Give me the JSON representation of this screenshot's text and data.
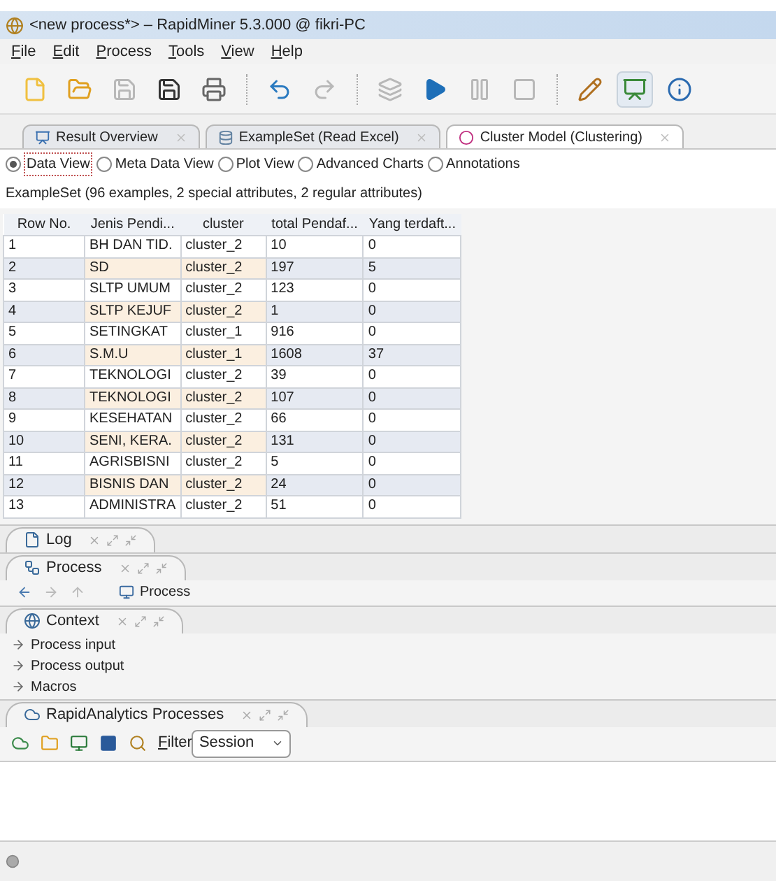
{
  "window": {
    "title": "<new process*> – RapidMiner 5.3.000 @ fikri-PC"
  },
  "menu": [
    {
      "label": "File"
    },
    {
      "label": "Edit"
    },
    {
      "label": "Process"
    },
    {
      "label": "Tools"
    },
    {
      "label": "View"
    },
    {
      "label": "Help"
    }
  ],
  "toolbar": [
    {
      "kind": "new",
      "disabled": false
    },
    {
      "kind": "open",
      "disabled": false
    },
    {
      "kind": "save",
      "disabled": true
    },
    {
      "kind": "saveas",
      "disabled": false
    },
    {
      "kind": "print",
      "disabled": false
    },
    {
      "kind": "sep"
    },
    {
      "kind": "undo",
      "disabled": false
    },
    {
      "kind": "redo",
      "disabled": true
    },
    {
      "kind": "sep"
    },
    {
      "kind": "stack",
      "disabled": true
    },
    {
      "kind": "run",
      "disabled": false
    },
    {
      "kind": "pause",
      "disabled": true
    },
    {
      "kind": "stop",
      "disabled": true
    },
    {
      "kind": "sep"
    },
    {
      "kind": "design",
      "disabled": false,
      "selected": false
    },
    {
      "kind": "results",
      "disabled": false,
      "selected": true
    },
    {
      "kind": "info",
      "disabled": false
    }
  ],
  "result_tabs": [
    {
      "label": "Result Overview",
      "kind": "overview",
      "selected": false
    },
    {
      "label": "ExampleSet (Read Excel)",
      "kind": "table",
      "selected": false
    },
    {
      "label": "Cluster Model (Clustering)",
      "kind": "cluster",
      "selected": true
    }
  ],
  "views": [
    {
      "label": "Data View",
      "selected": true
    },
    {
      "label": "Meta Data View",
      "selected": false
    },
    {
      "label": "Plot View",
      "selected": false
    },
    {
      "label": "Advanced Charts",
      "selected": false
    },
    {
      "label": "Annotations",
      "selected": false
    }
  ],
  "summary": "ExampleSet (96 examples, 2 special attributes, 2 regular attributes)",
  "table": {
    "columns": [
      "Row No.",
      "Jenis Pendi...",
      "cluster",
      "total Pendaf...",
      "Yang terdaft..."
    ],
    "rows": [
      [
        "1",
        "BH DAN TID.",
        "cluster_2",
        "10",
        "0"
      ],
      [
        "2",
        "SD",
        "cluster_2",
        "197",
        "5"
      ],
      [
        "3",
        "SLTP UMUM",
        "cluster_2",
        "123",
        "0"
      ],
      [
        "4",
        "SLTP KEJUF",
        "cluster_2",
        "1",
        "0"
      ],
      [
        "5",
        "SETINGKAT",
        "cluster_1",
        "916",
        "0"
      ],
      [
        "6",
        "S.M.U",
        "cluster_1",
        "1608",
        "37"
      ],
      [
        "7",
        "TEKNOLOGI",
        "cluster_2",
        "39",
        "0"
      ],
      [
        "8",
        "TEKNOLOGI",
        "cluster_2",
        "107",
        "0"
      ],
      [
        "9",
        "KESEHATAN",
        "cluster_2",
        "66",
        "0"
      ],
      [
        "10",
        "SENI, KERA.",
        "cluster_2",
        "131",
        "0"
      ],
      [
        "11",
        "AGRISBISNI",
        "cluster_2",
        "5",
        "0"
      ],
      [
        "12",
        "BISNIS DAN",
        "cluster_2",
        "24",
        "0"
      ],
      [
        "13",
        "ADMINISTRA",
        "cluster_2",
        "51",
        "0"
      ]
    ]
  },
  "panels": [
    {
      "title": "Log",
      "kind": "log"
    },
    {
      "title": "Process",
      "kind": "process",
      "lines": [
        "Process"
      ]
    },
    {
      "title": "Context",
      "kind": "context",
      "lines": [
        "Process input",
        "Process output",
        "Macros"
      ]
    },
    {
      "title": "RapidAnalytics Processes",
      "kind": "repo"
    }
  ],
  "repo_toolbar": {
    "filter_label": "Filter",
    "filter_value": "Session"
  }
}
